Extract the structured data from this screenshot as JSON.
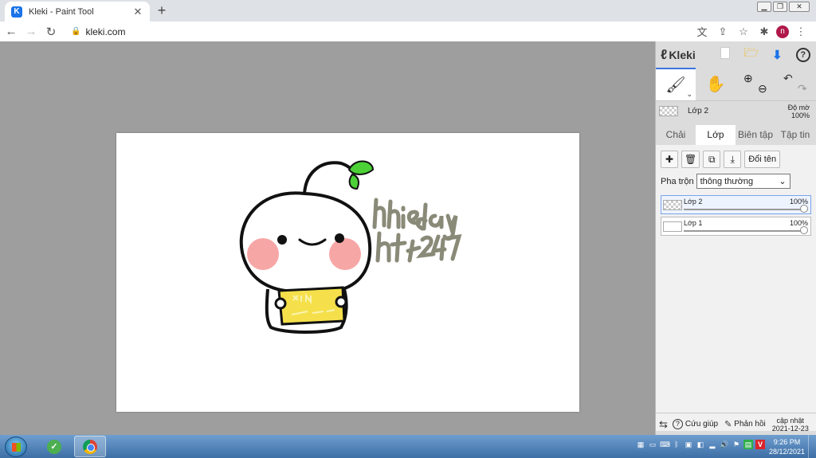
{
  "browser": {
    "tab_title": "Kleki - Paint Tool",
    "tab_icon": "kleki-favicon",
    "url": "kleki.com",
    "profile_initial": "n"
  },
  "panel": {
    "logo": "Kleki",
    "current_layer": "Lớp 2",
    "opacity_label": "Độ mờ",
    "opacity_value": "100%",
    "tabs": [
      {
        "label": "Chải",
        "active": false
      },
      {
        "label": "Lớp",
        "active": true
      },
      {
        "label": "Biên tập",
        "active": false
      },
      {
        "label": "Tập tin",
        "active": false
      }
    ],
    "rename_label": "Đổi tên",
    "blend_label": "Pha trộn",
    "blend_value": "thông thường",
    "layers": [
      {
        "name": "Lớp 2",
        "opacity": "100%",
        "selected": true
      },
      {
        "name": "Lớp 1",
        "opacity": "100%",
        "selected": false
      }
    ],
    "footer": {
      "help": "Cứu giúp",
      "feedback": "Phản hồi",
      "update_label": "cập nhật",
      "update_date": "2021-12-23"
    }
  },
  "taskbar": {
    "time": "9:26 PM",
    "date": "28/12/2021"
  },
  "colors": {
    "accent": "#3b73e0",
    "download": "#1a73e8",
    "save": "#f0b400",
    "leaf": "#4cd137",
    "cheek": "#f7a6a6",
    "handwriting": "#8a8a78",
    "sign_yellow": "#f5e04b"
  }
}
